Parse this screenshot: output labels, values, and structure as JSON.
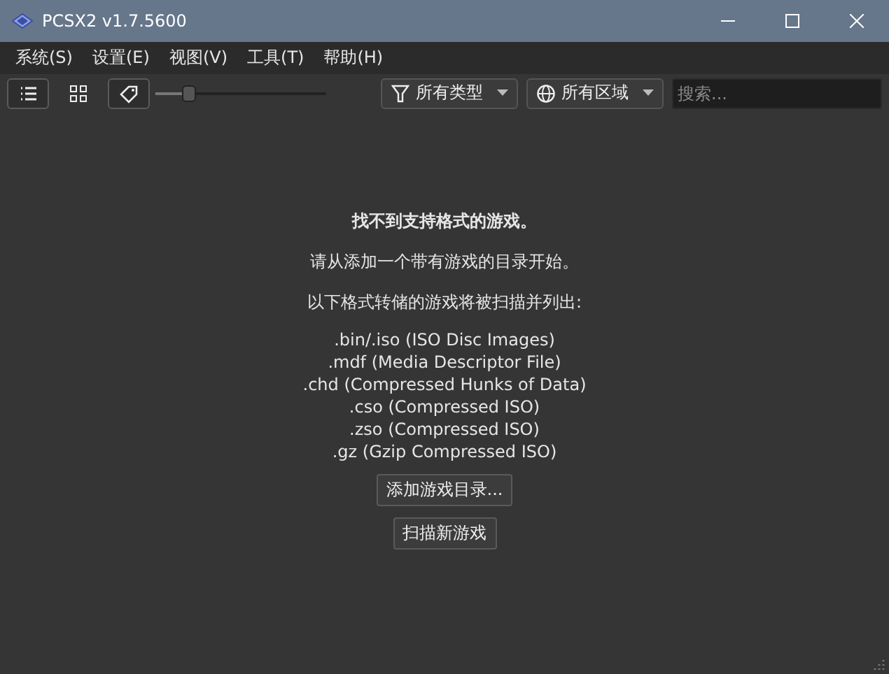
{
  "window": {
    "title": "PCSX2 v1.7.5600"
  },
  "menu": [
    "系统(S)",
    "设置(E)",
    "视图(V)",
    "工具(T)",
    "帮助(H)"
  ],
  "toolbar": {
    "view_buttons": [
      {
        "kind": "list",
        "selected": true
      },
      {
        "kind": "grid",
        "selected": false
      }
    ],
    "show_titles": {
      "on": true
    },
    "zoom_slider": {
      "level": 0.2
    },
    "filters": [
      {
        "kind": "type",
        "label": "所有类型"
      },
      {
        "kind": "region",
        "label": "所有区域"
      }
    ],
    "search": {
      "placeholder": "搜索..."
    }
  },
  "empty_state": {
    "heading": "找不到支持格式的游戏。",
    "hint": "请从添加一个带有游戏的目录开始。",
    "formats_intro": "以下格式转储的游戏将被扫描并列出:",
    "formats": [
      ".bin/.iso (ISO Disc Images)",
      ".mdf (Media Descriptor File)",
      ".chd (Compressed Hunks of Data)",
      ".cso (Compressed ISO)",
      ".zso (Compressed ISO)",
      ".gz (Gzip Compressed ISO)"
    ],
    "buttons": [
      "添加游戏目录...",
      "扫描新游戏"
    ]
  }
}
